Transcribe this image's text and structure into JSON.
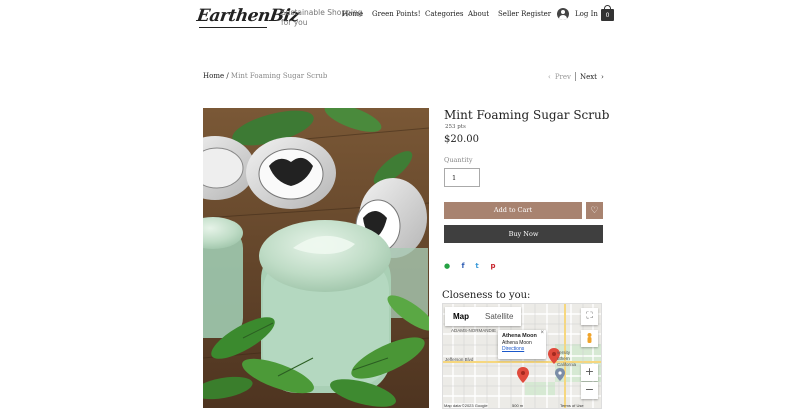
{
  "header": {
    "logo": "EarthenBiz",
    "tagline": "Sustainable Shopping for you",
    "nav": [
      "Home",
      "Green Points!",
      "Categories",
      "About",
      "Seller Register"
    ],
    "login_label": "Log In",
    "cart_count": "0"
  },
  "breadcrumb": {
    "home": "Home",
    "separator": " / ",
    "current": "Mint Foaming Sugar Scrub"
  },
  "pager": {
    "prev": "Prev",
    "next": "Next"
  },
  "product": {
    "title": "Mint Foaming Sugar Scrub",
    "points": "253 pts",
    "price": "$20.00",
    "quantity_label": "Quantity",
    "quantity_value": "1",
    "add_to_cart": "Add to Cart",
    "buy_now": "Buy Now"
  },
  "share": {
    "whatsapp": "●",
    "facebook": "f",
    "twitter": "t",
    "pinterest": "p"
  },
  "closeness": {
    "title": "Closeness to you:",
    "map_tab": "Map",
    "satellite_tab": "Satellite",
    "info_title": "Athena Moon",
    "info_subtitle": "Athena Moon",
    "info_link": "Directions",
    "close": "×",
    "street_1": "ADAMS-NORMANDIE",
    "street_2": "Jefferson Blvd",
    "street_3": "versity",
    "street_4": "uthern",
    "street_5": "California",
    "footer_attrib": "Map data ©2023 Google",
    "footer_scale": "500 m",
    "footer_terms": "Terms of Use"
  }
}
